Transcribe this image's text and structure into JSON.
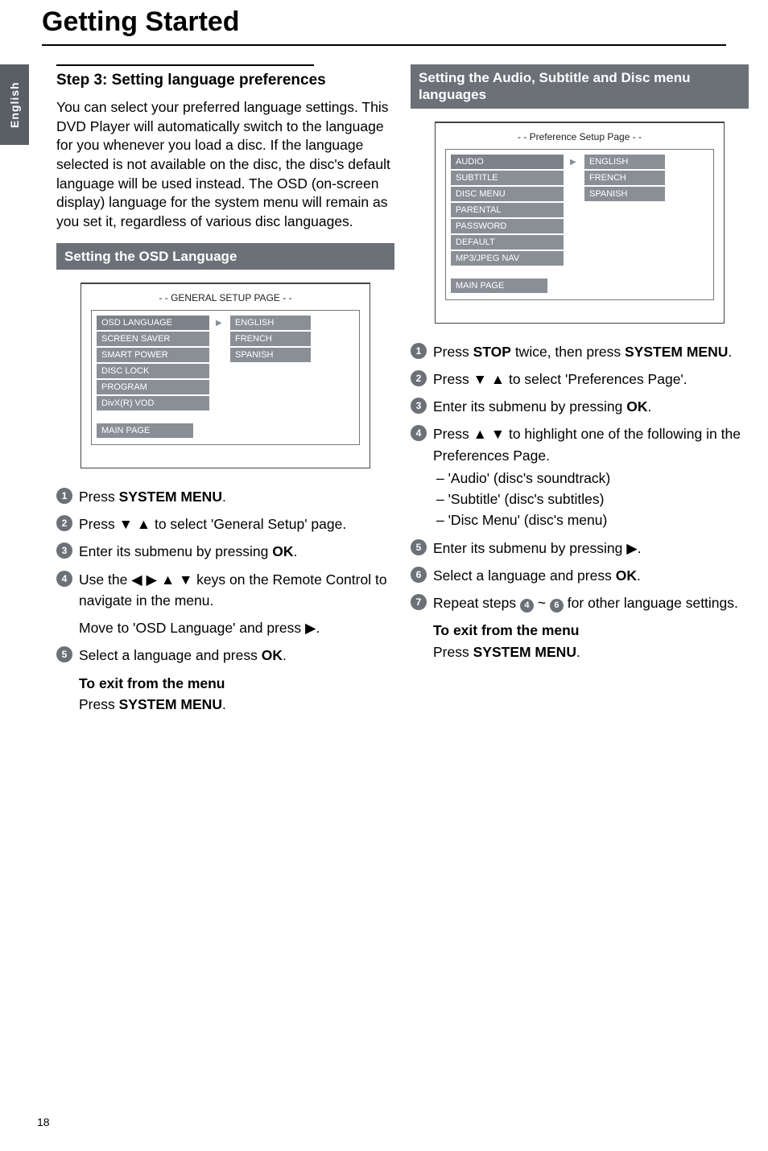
{
  "language_tab": "English",
  "page_title": "Getting Started",
  "page_number": "18",
  "left": {
    "step_head": "Step 3:  Setting language preferences",
    "lead": "You can select your preferred language settings. This DVD Player will automatically switch to the language for you whenever you load a disc.  If the language selected is not available on the disc, the disc's default language will be used instead.  The OSD (on-screen display) language for the system menu will remain as you set it, regardless of various disc languages.",
    "bar": "Setting the OSD Language",
    "ui": {
      "header": "- - GENERAL SETUP PAGE - -",
      "left_items": [
        "OSD LANGUAGE",
        "SCREEN SAVER",
        "SMART POWER",
        "DISC LOCK",
        "PROGRAM",
        "DivX(R) VOD"
      ],
      "right_items": [
        "ENGLISH",
        "FRENCH",
        "SPANISH"
      ],
      "main": "MAIN PAGE"
    },
    "s1_a": "Press ",
    "s1_b": "SYSTEM MENU",
    "s1_c": ".",
    "s2_a": "Press ▼ ▲ to select 'General Setup' page.",
    "s3_a": "Enter its submenu by pressing ",
    "s3_b": "OK",
    "s3_c": ".",
    "s4_a": "Use the ◀ ▶ ▲ ▼ keys on the Remote Control to navigate in the menu.",
    "s4_b": "Move to 'OSD Language' and press ▶.",
    "s5_a": "Select a language and press ",
    "s5_b": "OK",
    "s5_c": ".",
    "exit_head": "To exit from the menu",
    "exit_a": "Press ",
    "exit_b": "SYSTEM MENU",
    "exit_c": "."
  },
  "right": {
    "bar": "Setting the Audio, Subtitle and Disc menu languages",
    "ui": {
      "header": "- - Preference Setup Page - -",
      "left_items": [
        "AUDIO",
        "SUBTITLE",
        "DISC MENU",
        "PARENTAL",
        "PASSWORD",
        "DEFAULT",
        "MP3/JPEG NAV"
      ],
      "right_items": [
        "ENGLISH",
        "FRENCH",
        "SPANISH"
      ],
      "main": "MAIN PAGE"
    },
    "s1_a": "Press ",
    "s1_b": "STOP",
    "s1_c": " twice, then press ",
    "s1_d": "SYSTEM MENU",
    "s1_e": ".",
    "s2_a": "Press ▼ ▲ to select 'Preferences Page'.",
    "s3_a": "Enter its submenu by pressing ",
    "s3_b": "OK",
    "s3_c": ".",
    "s4_a": "Press ▲ ▼ to highlight one of the following in the Preferences Page.",
    "s4_li1": "–  'Audio' (disc's soundtrack)",
    "s4_li2": "–  'Subtitle' (disc's subtitles)",
    "s4_li3": "–  'Disc Menu' (disc's menu)",
    "s5_a": "Enter its submenu by pressing ▶.",
    "s6_a": "Select a language and press ",
    "s6_b": "OK",
    "s6_c": ".",
    "s7_a": "Repeat steps ",
    "s7_b": " ~ ",
    "s7_c": " for other language settings.",
    "exit_head": "To exit from the menu",
    "exit_a": "Press ",
    "exit_b": "SYSTEM MENU",
    "exit_c": "."
  }
}
